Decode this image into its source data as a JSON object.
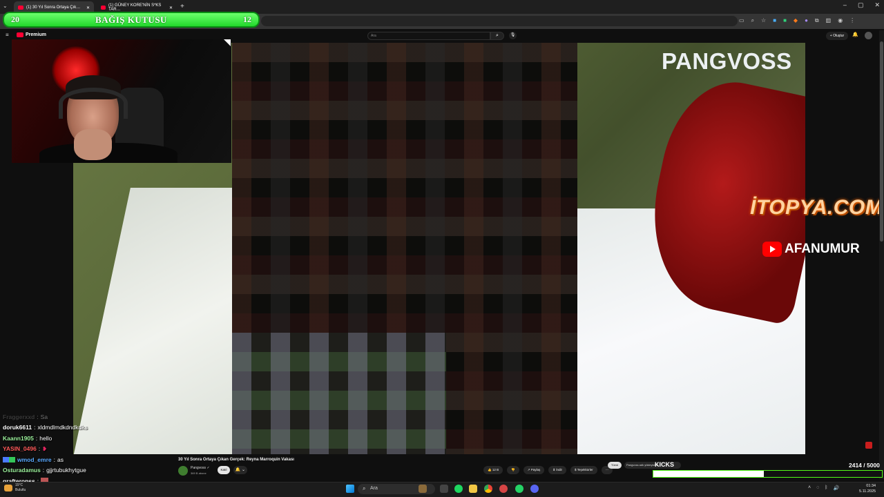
{
  "browser": {
    "tabs": [
      {
        "label": "(1) 30 Yıl Sonra Ortaya Çık…",
        "active": true
      },
      {
        "label": "(1) GÜNEY KORE'NİN S*KS TAR…",
        "active": false
      }
    ],
    "new_tab": "+",
    "window_controls": [
      "–",
      "▢",
      "✕"
    ]
  },
  "donation_bar": {
    "left_value": "20",
    "title": "BAĞIŞ KUTUSU",
    "right_value": "12",
    "color": "#2ee03a"
  },
  "youtube": {
    "logo_text": "Premium",
    "search_placeholder": "Ara",
    "create_label": "+ Oluştur"
  },
  "video": {
    "watermark": "PANGVOSS",
    "sponsor_1": "İTOPYA.COM",
    "sponsor_2": "AFANUMUR",
    "title": "30 Yıl Sonra Ortaya Çıkan Gerçek: Reyna Marroquin Vakası",
    "channel": {
      "name": "Pangvoss ✓",
      "subs": "369 B abone"
    },
    "join_label": "Katıl",
    "bell_label": "🔔 ⌄",
    "actions": [
      {
        "icon": "like-icon",
        "label": "👍 12 B"
      },
      {
        "icon": "dislike-icon",
        "label": "👎"
      },
      {
        "icon": "share-icon",
        "label": "↗ Paylaş"
      },
      {
        "icon": "download-icon",
        "label": "⬇ İndir"
      },
      {
        "icon": "thanks-icon",
        "label": "$ Teşekkürler"
      },
      {
        "icon": "more-icon",
        "label": "⋯"
      }
    ]
  },
  "chat": [
    {
      "user": "Fraggerxxd",
      "text": "Sa",
      "color": "#777777",
      "dim": true
    },
    {
      "user": "doruk6611",
      "text": "xldmdlmdkdndkdks",
      "color": "#ffffff"
    },
    {
      "user": "Kaann1905",
      "text": "hello",
      "color": "#9cf29c"
    },
    {
      "user": "YASIN_0496",
      "text": "",
      "color": "#ff5a5a",
      "heart": true
    },
    {
      "user": "wmod_emre",
      "text": "as",
      "color": "#5aa9ff",
      "badges": true
    },
    {
      "user": "Osturadamus",
      "text": "gjjrtubukhytgue",
      "color": "#9cf29c"
    },
    {
      "user": "grafteropss",
      "text": "",
      "color": "#ffffff",
      "avatar": true
    }
  ],
  "kick": {
    "chip_1": "Tümü",
    "chip_2": "Pangvoss adlı yükleyicide…",
    "label": "KICKS",
    "current": 2414,
    "goal": 5000,
    "count_text": "2414 / 5000",
    "accent": "#53fc18"
  },
  "taskbar": {
    "weather_temp": "15°C",
    "weather_desc": "Bulutlu",
    "search_placeholder": "Ara",
    "time": "01:34",
    "date": "5.11.2025"
  }
}
